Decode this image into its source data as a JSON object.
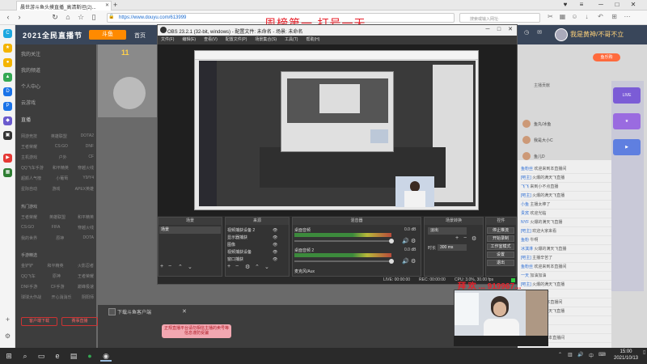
{
  "browser": {
    "tab_title": "晨世游斗鱼头摸直播_高清斯坦(2)...",
    "url": "https://www.douyu.com/613999",
    "search_placeholder": "搜索或输入网址·"
  },
  "overlay": {
    "top_text": "周榜第一 打号一天",
    "bottom_text": "拜 欢 ... 919967..."
  },
  "douyu": {
    "logo": "2021全民直播节",
    "logo_badge": "斗鱼",
    "home": "首页",
    "username": "我是黄神/不哥不立",
    "rank_number": "11",
    "sidebar": [
      "我的关注",
      "我的频道",
      "个人中心",
      "云游戏"
    ],
    "category_header": "直播",
    "grid_rows": [
      [
        "网游竞技",
        "英雄联盟",
        "DOTA2"
      ],
      [
        "王者荣耀",
        "CS:GO",
        "DNF"
      ],
      [
        "主机游戏",
        "户外",
        "CF"
      ],
      [
        "QQ飞车手游",
        "和平精英",
        "穿越火线"
      ],
      [
        "超颜人气榜",
        "小葡萄",
        "Y9/Y4"
      ],
      [
        "星际自动",
        "游戏",
        "APEX英雄"
      ]
    ],
    "grid_rows_b": [
      [
        "热门游戏",
        "",
        ""
      ],
      [
        "王者荣耀",
        "英雄联盟",
        "和平精英"
      ],
      [
        "CS:GO",
        "FIFA",
        "穿越火线"
      ],
      [
        "我的世界",
        "原神",
        "DOTA"
      ]
    ],
    "grid_rows_c": [
      [
        "手游精选",
        "",
        ""
      ],
      [
        "金铲铲",
        "和平精英",
        "火影忍者"
      ],
      [
        "QQ飞车",
        "原神",
        "王者荣耀"
      ],
      [
        "DNF手游",
        "CF手游",
        "巅峰极速"
      ],
      [
        "球球大作战",
        "开心消消乐",
        "阴阳师"
      ]
    ],
    "red_buttons": [
      "客户端下载",
      "赛事直播"
    ],
    "download_bar": "下载斗鱼客户端",
    "warning": "正规直播平台请勿相信主播的卖号等信息谨防受骗",
    "gift_tag": "鱼乐购",
    "rank_header": "主播贡献",
    "rank_names": [
      "鱼丸/冰鱼",
      "我是大小C",
      "鱼儿D",
      "圆圈子"
    ],
    "chat": [
      {
        "name": "鱼粉丝",
        "text": "欢迎来到本直播间"
      },
      {
        "name": "[吧主]",
        "text": "火爆的满天飞直播"
      },
      {
        "name": "飞飞",
        "text": "来到小不点直播"
      },
      {
        "name": "[吧主]",
        "text": "火爆的满天飞直播"
      },
      {
        "name": "小鱼",
        "text": "主播太棒了"
      },
      {
        "name": "贵宾",
        "text": "欢迎光临"
      },
      {
        "name": "NYF",
        "text": "火爆的满天飞直播"
      },
      {
        "name": "[吧主]",
        "text": "欢迎大家来看"
      },
      {
        "name": "鱼粉",
        "text": "牛啊"
      },
      {
        "name": "冰淇淋",
        "text": "火爆的满天飞直播"
      },
      {
        "name": "[吧主]",
        "text": "主播辛苦了"
      },
      {
        "name": "鱼粉丝",
        "text": "欢迎来到本直播间"
      },
      {
        "name": "一天",
        "text": "加油加油"
      },
      {
        "name": "[吧主]",
        "text": "火爆的满天飞直播"
      },
      {
        "name": "小C",
        "text": "主播辛苦了"
      },
      {
        "name": "鱼友",
        "text": "欢迎来到本直播间"
      },
      {
        "name": "[吧主]",
        "text": "火爆的满天飞直播"
      },
      {
        "name": "吧主",
        "text": "欢迎"
      },
      {
        "name": "鱼粉",
        "text": "牛啊"
      },
      {
        "name": "[吧主]",
        "text": "欢迎来到本直播间"
      }
    ]
  },
  "obs": {
    "title": "OBS 23.2.1 (32-bit, windows) - 配置文件: 未命名 - 场景: 未命名",
    "menu": [
      "文件(F)",
      "编辑(E)",
      "查看(V)",
      "配置文件(P)",
      "场景集合(S)",
      "工具(T)",
      "帮助(H)"
    ],
    "docks": {
      "scenes": "场景",
      "sources": "来源",
      "mixer": "混音器",
      "transitions": "场景转换",
      "controls": "控件"
    },
    "scene_item": "场景",
    "sources": [
      "视频捕获设备 2",
      "显示器捕获",
      "图像",
      "视频捕获设备",
      "窗口捕获"
    ],
    "mixer_tracks": [
      {
        "name": "桌面音频",
        "db": "0.0 dB"
      },
      {
        "name": "桌面音频 2",
        "db": "0.0 dB"
      },
      {
        "name": "麦克风/Aux",
        "db": "0.0 dB"
      }
    ],
    "transition": "淡出",
    "duration_label": "时长",
    "duration_value": "300 ms",
    "controls": [
      "停止推流",
      "开始录制",
      "工作室模式",
      "设置",
      "退出"
    ],
    "status": {
      "live": "LIVE: 00:00:00",
      "rec": "REC: 00:00:00",
      "cpu": "CPU: 3.0%, 30.00 fps"
    }
  },
  "taskbar": {
    "time": "15:00",
    "date": "2021/10/13"
  }
}
